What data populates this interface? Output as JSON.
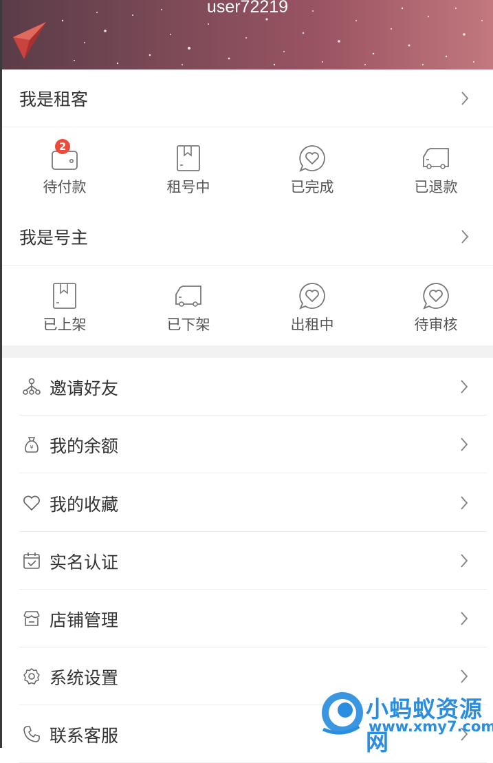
{
  "header": {
    "username": "user72219"
  },
  "tenant": {
    "title": "我是租客",
    "items": [
      {
        "label": "待付款",
        "icon": "wallet-icon",
        "badge": "2"
      },
      {
        "label": "租号中",
        "icon": "bookmark-icon"
      },
      {
        "label": "已完成",
        "icon": "heart-chat-icon"
      },
      {
        "label": "已退款",
        "icon": "truck-icon"
      }
    ]
  },
  "owner": {
    "title": "我是号主",
    "items": [
      {
        "label": "已上架",
        "icon": "bookmark-icon"
      },
      {
        "label": "已下架",
        "icon": "truck-icon"
      },
      {
        "label": "出租中",
        "icon": "heart-chat-icon"
      },
      {
        "label": "待审核",
        "icon": "heart-chat-icon"
      }
    ]
  },
  "menu": [
    {
      "label": "邀请好友",
      "icon": "share-network-icon"
    },
    {
      "label": "我的余额",
      "icon": "money-bag-icon"
    },
    {
      "label": "我的收藏",
      "icon": "heart-icon"
    },
    {
      "label": "实名认证",
      "icon": "calendar-check-icon"
    },
    {
      "label": "店铺管理",
      "icon": "shop-icon"
    },
    {
      "label": "系统设置",
      "icon": "gear-icon"
    },
    {
      "label": "联系客服",
      "icon": "phone-icon"
    }
  ],
  "watermark": {
    "title": "小蚂蚁资源网",
    "url": "www.xmy7.com"
  },
  "colors": {
    "badge": "#ee4a3a",
    "header_start": "#5a3c48",
    "header_end": "#c2787e",
    "watermark": "#2a8de0"
  }
}
